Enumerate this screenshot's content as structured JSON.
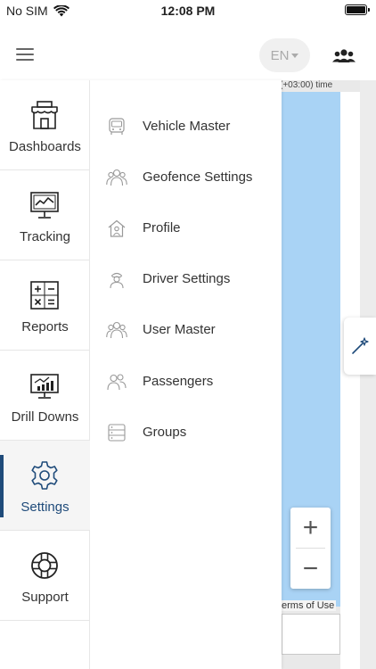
{
  "status_bar": {
    "carrier": "No SIM",
    "time": "12:08 PM"
  },
  "header": {
    "language": "EN"
  },
  "map": {
    "timezone_text": "(+03:00) time",
    "zoom_in": "+",
    "zoom_out": "−",
    "terms_text": "erms of Use"
  },
  "rail": {
    "items": [
      {
        "label": "Dashboards",
        "icon": "store-icon"
      },
      {
        "label": "Tracking",
        "icon": "monitor-tracking-icon"
      },
      {
        "label": "Reports",
        "icon": "calculator-icon"
      },
      {
        "label": "Drill Downs",
        "icon": "chart-board-icon"
      },
      {
        "label": "Settings",
        "icon": "gear-icon",
        "active": true
      },
      {
        "label": "Support",
        "icon": "lifebuoy-icon"
      }
    ]
  },
  "submenu": {
    "items": [
      {
        "label": "Vehicle Master",
        "icon": "vehicle-icon"
      },
      {
        "label": "Geofence Settings",
        "icon": "users-group-icon"
      },
      {
        "label": "Profile",
        "icon": "home-profile-icon"
      },
      {
        "label": "Driver Settings",
        "icon": "driver-icon"
      },
      {
        "label": "User Master",
        "icon": "users-group-icon"
      },
      {
        "label": "Passengers",
        "icon": "passengers-icon"
      },
      {
        "label": "Groups",
        "icon": "groups-server-icon"
      }
    ]
  },
  "colors": {
    "accent": "#1f4b7a",
    "water": "#a9d3f5",
    "text": "#333333"
  }
}
